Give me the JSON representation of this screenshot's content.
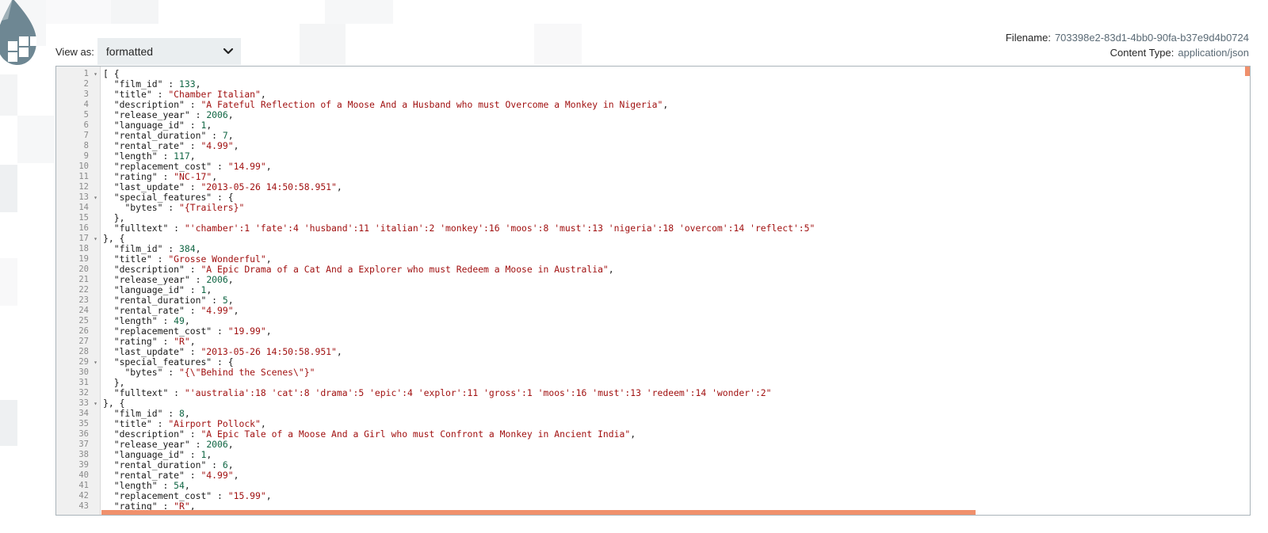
{
  "viewer": {
    "view_as_label": "View as:",
    "view_as_value": "formatted",
    "filename_label": "Filename:",
    "filename_value": "703398e2-83d1-4bb0-90fa-b37e9d4b0724",
    "content_type_label": "Content Type:",
    "content_type_value": "application/json"
  },
  "colors": {
    "accent": "#f0906c",
    "string": "#a11111",
    "number": "#116644",
    "select_bg": "#eaeef0"
  },
  "icons": {
    "logo": "flowfile-drop-logo",
    "select": "chevron-down-icon",
    "fold": "fold-arrow-icon"
  },
  "editor": {
    "fold_lines": [
      1,
      13,
      17,
      29,
      33
    ],
    "lines": [
      [
        {
          "t": "p",
          "v": "[ {"
        }
      ],
      [
        {
          "t": "p",
          "v": "  "
        },
        {
          "t": "k",
          "v": "\"film_id\""
        },
        {
          "t": "p",
          "v": " : "
        },
        {
          "t": "n",
          "v": "133"
        },
        {
          "t": "p",
          "v": ","
        }
      ],
      [
        {
          "t": "p",
          "v": "  "
        },
        {
          "t": "k",
          "v": "\"title\""
        },
        {
          "t": "p",
          "v": " : "
        },
        {
          "t": "s",
          "v": "\"Chamber Italian\""
        },
        {
          "t": "p",
          "v": ","
        }
      ],
      [
        {
          "t": "p",
          "v": "  "
        },
        {
          "t": "k",
          "v": "\"description\""
        },
        {
          "t": "p",
          "v": " : "
        },
        {
          "t": "s",
          "v": "\"A Fateful Reflection of a Moose And a Husband who must Overcome a Monkey in Nigeria\""
        },
        {
          "t": "p",
          "v": ","
        }
      ],
      [
        {
          "t": "p",
          "v": "  "
        },
        {
          "t": "k",
          "v": "\"release_year\""
        },
        {
          "t": "p",
          "v": " : "
        },
        {
          "t": "n",
          "v": "2006"
        },
        {
          "t": "p",
          "v": ","
        }
      ],
      [
        {
          "t": "p",
          "v": "  "
        },
        {
          "t": "k",
          "v": "\"language_id\""
        },
        {
          "t": "p",
          "v": " : "
        },
        {
          "t": "n",
          "v": "1"
        },
        {
          "t": "p",
          "v": ","
        }
      ],
      [
        {
          "t": "p",
          "v": "  "
        },
        {
          "t": "k",
          "v": "\"rental_duration\""
        },
        {
          "t": "p",
          "v": " : "
        },
        {
          "t": "n",
          "v": "7"
        },
        {
          "t": "p",
          "v": ","
        }
      ],
      [
        {
          "t": "p",
          "v": "  "
        },
        {
          "t": "k",
          "v": "\"rental_rate\""
        },
        {
          "t": "p",
          "v": " : "
        },
        {
          "t": "s",
          "v": "\"4.99\""
        },
        {
          "t": "p",
          "v": ","
        }
      ],
      [
        {
          "t": "p",
          "v": "  "
        },
        {
          "t": "k",
          "v": "\"length\""
        },
        {
          "t": "p",
          "v": " : "
        },
        {
          "t": "n",
          "v": "117"
        },
        {
          "t": "p",
          "v": ","
        }
      ],
      [
        {
          "t": "p",
          "v": "  "
        },
        {
          "t": "k",
          "v": "\"replacement_cost\""
        },
        {
          "t": "p",
          "v": " : "
        },
        {
          "t": "s",
          "v": "\"14.99\""
        },
        {
          "t": "p",
          "v": ","
        }
      ],
      [
        {
          "t": "p",
          "v": "  "
        },
        {
          "t": "k",
          "v": "\"rating\""
        },
        {
          "t": "p",
          "v": " : "
        },
        {
          "t": "s",
          "v": "\"NC-17\""
        },
        {
          "t": "p",
          "v": ","
        }
      ],
      [
        {
          "t": "p",
          "v": "  "
        },
        {
          "t": "k",
          "v": "\"last_update\""
        },
        {
          "t": "p",
          "v": " : "
        },
        {
          "t": "s",
          "v": "\"2013-05-26 14:50:58.951\""
        },
        {
          "t": "p",
          "v": ","
        }
      ],
      [
        {
          "t": "p",
          "v": "  "
        },
        {
          "t": "k",
          "v": "\"special_features\""
        },
        {
          "t": "p",
          "v": " : {"
        }
      ],
      [
        {
          "t": "p",
          "v": "    "
        },
        {
          "t": "k",
          "v": "\"bytes\""
        },
        {
          "t": "p",
          "v": " : "
        },
        {
          "t": "s",
          "v": "\"{Trailers}\""
        }
      ],
      [
        {
          "t": "p",
          "v": "  },"
        }
      ],
      [
        {
          "t": "p",
          "v": "  "
        },
        {
          "t": "k",
          "v": "\"fulltext\""
        },
        {
          "t": "p",
          "v": " : "
        },
        {
          "t": "s",
          "v": "\"'chamber':1 'fate':4 'husband':11 'italian':2 'monkey':16 'moos':8 'must':13 'nigeria':18 'overcom':14 'reflect':5\""
        }
      ],
      [
        {
          "t": "p",
          "v": "}, {"
        }
      ],
      [
        {
          "t": "p",
          "v": "  "
        },
        {
          "t": "k",
          "v": "\"film_id\""
        },
        {
          "t": "p",
          "v": " : "
        },
        {
          "t": "n",
          "v": "384"
        },
        {
          "t": "p",
          "v": ","
        }
      ],
      [
        {
          "t": "p",
          "v": "  "
        },
        {
          "t": "k",
          "v": "\"title\""
        },
        {
          "t": "p",
          "v": " : "
        },
        {
          "t": "s",
          "v": "\"Grosse Wonderful\""
        },
        {
          "t": "p",
          "v": ","
        }
      ],
      [
        {
          "t": "p",
          "v": "  "
        },
        {
          "t": "k",
          "v": "\"description\""
        },
        {
          "t": "p",
          "v": " : "
        },
        {
          "t": "s",
          "v": "\"A Epic Drama of a Cat And a Explorer who must Redeem a Moose in Australia\""
        },
        {
          "t": "p",
          "v": ","
        }
      ],
      [
        {
          "t": "p",
          "v": "  "
        },
        {
          "t": "k",
          "v": "\"release_year\""
        },
        {
          "t": "p",
          "v": " : "
        },
        {
          "t": "n",
          "v": "2006"
        },
        {
          "t": "p",
          "v": ","
        }
      ],
      [
        {
          "t": "p",
          "v": "  "
        },
        {
          "t": "k",
          "v": "\"language_id\""
        },
        {
          "t": "p",
          "v": " : "
        },
        {
          "t": "n",
          "v": "1"
        },
        {
          "t": "p",
          "v": ","
        }
      ],
      [
        {
          "t": "p",
          "v": "  "
        },
        {
          "t": "k",
          "v": "\"rental_duration\""
        },
        {
          "t": "p",
          "v": " : "
        },
        {
          "t": "n",
          "v": "5"
        },
        {
          "t": "p",
          "v": ","
        }
      ],
      [
        {
          "t": "p",
          "v": "  "
        },
        {
          "t": "k",
          "v": "\"rental_rate\""
        },
        {
          "t": "p",
          "v": " : "
        },
        {
          "t": "s",
          "v": "\"4.99\""
        },
        {
          "t": "p",
          "v": ","
        }
      ],
      [
        {
          "t": "p",
          "v": "  "
        },
        {
          "t": "k",
          "v": "\"length\""
        },
        {
          "t": "p",
          "v": " : "
        },
        {
          "t": "n",
          "v": "49"
        },
        {
          "t": "p",
          "v": ","
        }
      ],
      [
        {
          "t": "p",
          "v": "  "
        },
        {
          "t": "k",
          "v": "\"replacement_cost\""
        },
        {
          "t": "p",
          "v": " : "
        },
        {
          "t": "s",
          "v": "\"19.99\""
        },
        {
          "t": "p",
          "v": ","
        }
      ],
      [
        {
          "t": "p",
          "v": "  "
        },
        {
          "t": "k",
          "v": "\"rating\""
        },
        {
          "t": "p",
          "v": " : "
        },
        {
          "t": "s",
          "v": "\"R\""
        },
        {
          "t": "p",
          "v": ","
        }
      ],
      [
        {
          "t": "p",
          "v": "  "
        },
        {
          "t": "k",
          "v": "\"last_update\""
        },
        {
          "t": "p",
          "v": " : "
        },
        {
          "t": "s",
          "v": "\"2013-05-26 14:50:58.951\""
        },
        {
          "t": "p",
          "v": ","
        }
      ],
      [
        {
          "t": "p",
          "v": "  "
        },
        {
          "t": "k",
          "v": "\"special_features\""
        },
        {
          "t": "p",
          "v": " : {"
        }
      ],
      [
        {
          "t": "p",
          "v": "    "
        },
        {
          "t": "k",
          "v": "\"bytes\""
        },
        {
          "t": "p",
          "v": " : "
        },
        {
          "t": "s",
          "v": "\"{\\\"Behind the Scenes\\\"}\""
        }
      ],
      [
        {
          "t": "p",
          "v": "  },"
        }
      ],
      [
        {
          "t": "p",
          "v": "  "
        },
        {
          "t": "k",
          "v": "\"fulltext\""
        },
        {
          "t": "p",
          "v": " : "
        },
        {
          "t": "s",
          "v": "\"'australia':18 'cat':8 'drama':5 'epic':4 'explor':11 'gross':1 'moos':16 'must':13 'redeem':14 'wonder':2\""
        }
      ],
      [
        {
          "t": "p",
          "v": "}, {"
        }
      ],
      [
        {
          "t": "p",
          "v": "  "
        },
        {
          "t": "k",
          "v": "\"film_id\""
        },
        {
          "t": "p",
          "v": " : "
        },
        {
          "t": "n",
          "v": "8"
        },
        {
          "t": "p",
          "v": ","
        }
      ],
      [
        {
          "t": "p",
          "v": "  "
        },
        {
          "t": "k",
          "v": "\"title\""
        },
        {
          "t": "p",
          "v": " : "
        },
        {
          "t": "s",
          "v": "\"Airport Pollock\""
        },
        {
          "t": "p",
          "v": ","
        }
      ],
      [
        {
          "t": "p",
          "v": "  "
        },
        {
          "t": "k",
          "v": "\"description\""
        },
        {
          "t": "p",
          "v": " : "
        },
        {
          "t": "s",
          "v": "\"A Epic Tale of a Moose And a Girl who must Confront a Monkey in Ancient India\""
        },
        {
          "t": "p",
          "v": ","
        }
      ],
      [
        {
          "t": "p",
          "v": "  "
        },
        {
          "t": "k",
          "v": "\"release_year\""
        },
        {
          "t": "p",
          "v": " : "
        },
        {
          "t": "n",
          "v": "2006"
        },
        {
          "t": "p",
          "v": ","
        }
      ],
      [
        {
          "t": "p",
          "v": "  "
        },
        {
          "t": "k",
          "v": "\"language_id\""
        },
        {
          "t": "p",
          "v": " : "
        },
        {
          "t": "n",
          "v": "1"
        },
        {
          "t": "p",
          "v": ","
        }
      ],
      [
        {
          "t": "p",
          "v": "  "
        },
        {
          "t": "k",
          "v": "\"rental_duration\""
        },
        {
          "t": "p",
          "v": " : "
        },
        {
          "t": "n",
          "v": "6"
        },
        {
          "t": "p",
          "v": ","
        }
      ],
      [
        {
          "t": "p",
          "v": "  "
        },
        {
          "t": "k",
          "v": "\"rental_rate\""
        },
        {
          "t": "p",
          "v": " : "
        },
        {
          "t": "s",
          "v": "\"4.99\""
        },
        {
          "t": "p",
          "v": ","
        }
      ],
      [
        {
          "t": "p",
          "v": "  "
        },
        {
          "t": "k",
          "v": "\"length\""
        },
        {
          "t": "p",
          "v": " : "
        },
        {
          "t": "n",
          "v": "54"
        },
        {
          "t": "p",
          "v": ","
        }
      ],
      [
        {
          "t": "p",
          "v": "  "
        },
        {
          "t": "k",
          "v": "\"replacement_cost\""
        },
        {
          "t": "p",
          "v": " : "
        },
        {
          "t": "s",
          "v": "\"15.99\""
        },
        {
          "t": "p",
          "v": ","
        }
      ],
      [
        {
          "t": "p",
          "v": "  "
        },
        {
          "t": "k",
          "v": "\"rating\""
        },
        {
          "t": "p",
          "v": " : "
        },
        {
          "t": "s",
          "v": "\"R\""
        },
        {
          "t": "p",
          "v": ","
        }
      ]
    ]
  }
}
